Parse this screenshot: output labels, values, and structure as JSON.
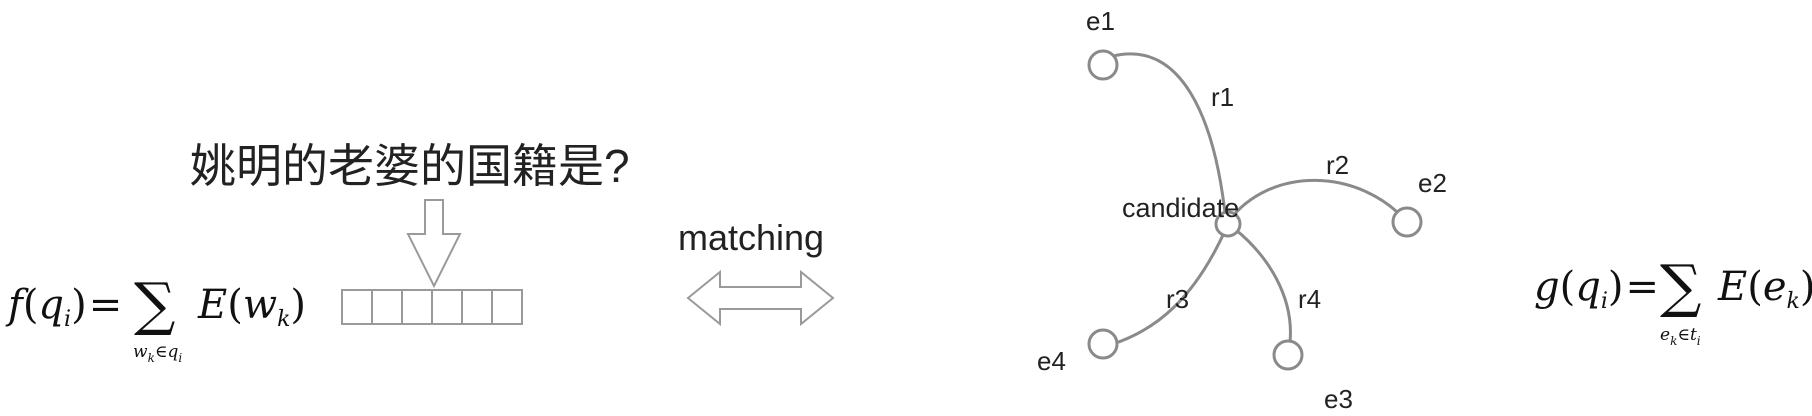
{
  "question": "姚明的老婆的国籍是?",
  "matching_label": "matching",
  "formula_left": {
    "f": "f",
    "q": "q",
    "i": "i",
    "eq": "=",
    "sigma": "∑",
    "E": "E",
    "w": "w",
    "k": "k",
    "sub": "w",
    "sub_k": "k",
    "sub_in": "∈",
    "sub_q": "q",
    "sub_i": "i",
    "lp": "(",
    "rp": ")"
  },
  "formula_right": {
    "g": "g",
    "q": "q",
    "i": "i",
    "eq": "=",
    "sigma": "∑",
    "E": "E",
    "e": "e",
    "k": "k",
    "sub": "e",
    "sub_k": "k",
    "sub_in": "∈",
    "sub_t": "t",
    "sub_i": "i",
    "lp": "(",
    "rp": ")"
  },
  "graph": {
    "center_label": "candidate",
    "entities": [
      "e1",
      "e2",
      "e3",
      "e4"
    ],
    "relations": [
      "r1",
      "r2",
      "r3",
      "r4"
    ]
  },
  "colors": {
    "edge": "#8a8a8a",
    "text": "#222222",
    "box": "#9a9a9a"
  }
}
